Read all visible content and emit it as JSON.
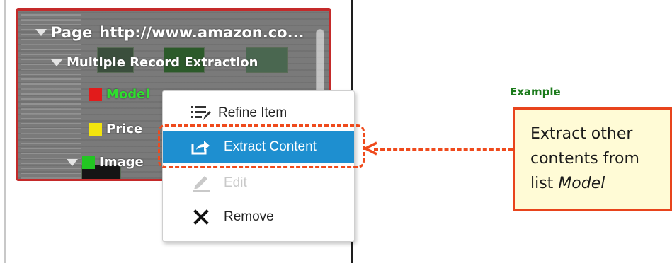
{
  "tree": {
    "page_label": "Page",
    "page_url": "http://www.amazon.co...",
    "mre_label": "Multiple Record Extraction",
    "fields": [
      {
        "label": "Model",
        "swatch": "#e21b1b",
        "text_color": "#2ee02e"
      },
      {
        "label": "Price",
        "swatch": "#f2e40d",
        "text_color": "#ffffff"
      },
      {
        "label": "Image",
        "swatch": "#22c522",
        "text_color": "#ffffff"
      }
    ]
  },
  "context_menu": {
    "items": [
      {
        "label": "Refine Item",
        "icon": "refine-list-icon",
        "state": "normal"
      },
      {
        "label": "Extract Content",
        "icon": "extract-share-icon",
        "state": "highlighted"
      },
      {
        "label": "Edit",
        "icon": "pencil-icon",
        "state": "disabled"
      },
      {
        "label": "Remove",
        "icon": "x-icon",
        "state": "normal"
      }
    ]
  },
  "annotation": {
    "example_label": "Example",
    "line1": "Extract other",
    "line2": "contents from",
    "line3_prefix": "list ",
    "line3_italic": "Model",
    "accent_color": "#ef4a1c",
    "label_color": "#1a7a1a"
  }
}
